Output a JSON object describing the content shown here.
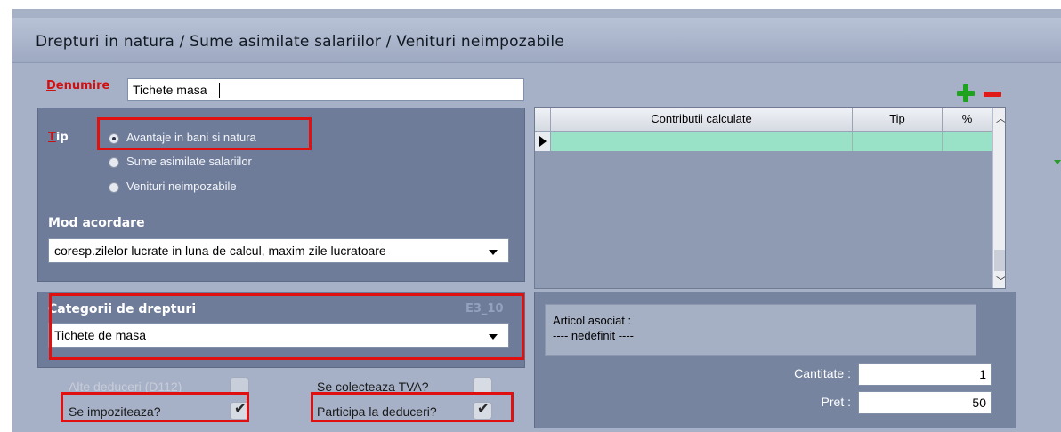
{
  "window": {
    "title": "Drepturi in natura / Sume asimilate salariilor / Venituri neimpozabile"
  },
  "denumire": {
    "label_accel": "D",
    "label_rest": "enumire",
    "value": "Tichete masa"
  },
  "tip": {
    "label_accel": "T",
    "label_rest": "ip",
    "options": [
      {
        "label": "Avantaje in bani si natura",
        "selected": true
      },
      {
        "label": "Sume asimilate salariilor",
        "selected": false
      },
      {
        "label": "Venituri neimpozabile",
        "selected": false
      }
    ]
  },
  "mod_acordare": {
    "label": "Mod acordare",
    "value": "coresp.zilelor lucrate in luna de calcul, maxim zile lucratoare"
  },
  "categorii": {
    "label": "Categorii de drepturi",
    "code": "E3_10",
    "value": "Tichete de masa"
  },
  "checks": {
    "alte_deduceri": {
      "label": "Alte deduceri (D112)",
      "checked": false,
      "enabled": false
    },
    "se_colecteaza_tva": {
      "label": "Se colecteaza TVA?",
      "checked": false
    },
    "se_impoziteaza": {
      "label": "Se impoziteaza?",
      "checked": true
    },
    "participa_deduceri": {
      "label": "Participa la deduceri?",
      "checked": true
    }
  },
  "grid": {
    "columns": [
      "Contributii calculate",
      "Tip",
      "%"
    ],
    "rows": [
      [
        "",
        "",
        ""
      ]
    ],
    "add_icon": "plus-icon",
    "remove_icon": "minus-icon"
  },
  "articol": {
    "label": "Articol asociat :",
    "value": "---- nedefinit ----"
  },
  "cantitate": {
    "label": "Cantitate :",
    "value": "1"
  },
  "pret": {
    "label": "Pret :",
    "value": "50"
  },
  "colors": {
    "accent_red": "#e01010",
    "row_selected": "#99e2c8",
    "panel_dark": "#6e7c99",
    "panel_light": "#a6b1c8"
  }
}
